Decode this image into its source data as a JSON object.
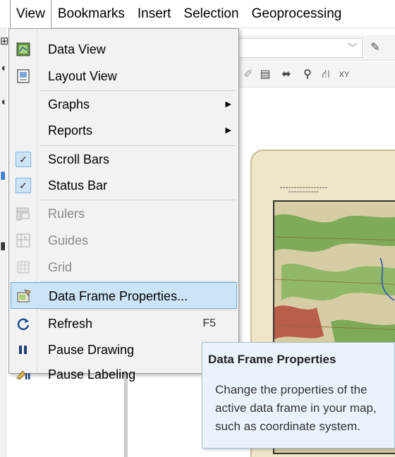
{
  "menubar": {
    "items": [
      "View",
      "Bookmarks",
      "Insert",
      "Selection",
      "Geoprocessing"
    ]
  },
  "menu": {
    "data_view": "Data View",
    "layout_view": "Layout View",
    "graphs": "Graphs",
    "reports": "Reports",
    "scroll_bars": "Scroll Bars",
    "status_bar": "Status Bar",
    "rulers": "Rulers",
    "guides": "Guides",
    "grid": "Grid",
    "data_frame_properties": "Data Frame Properties...",
    "refresh": "Refresh",
    "refresh_shortcut": "F5",
    "pause_drawing": "Pause Drawing",
    "pause_labeling": "Pause Labeling",
    "checked": [
      "Scroll Bars",
      "Status Bar"
    ],
    "disabled": [
      "Rulers",
      "Guides",
      "Grid"
    ],
    "highlighted": "Data Frame Properties..."
  },
  "tooltip": {
    "title": "Data Frame Properties",
    "body": "Change the properties of the active data frame in your map, such as coordinate system."
  },
  "icons": {
    "submenu": "chevron-right-icon",
    "check": "checkmark-icon"
  },
  "colors": {
    "highlight_bg": "#cce4f7",
    "highlight_border": "#6fa9dc",
    "tooltip_bg": "#eaf3fb",
    "menu_bg": "#f2f2f2"
  }
}
